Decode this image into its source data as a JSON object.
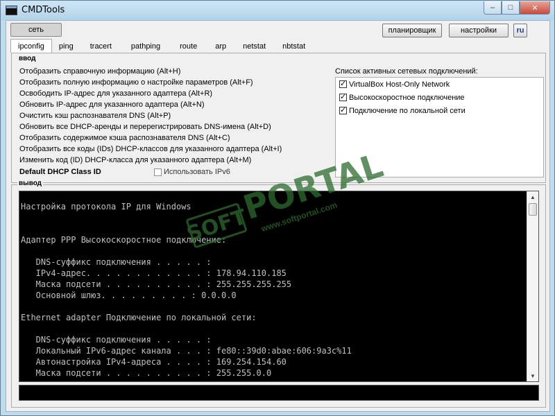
{
  "window": {
    "title": "CMDTools",
    "buttons": {
      "minimize": "–",
      "maximize": "□",
      "close": "✕"
    }
  },
  "toolbar": {
    "network_button": "сеть",
    "scheduler_button": "планировщик",
    "settings_button": "настройки",
    "language_button": "ru"
  },
  "tabs": [
    "ipconfig",
    "ping",
    "tracert",
    "pathping",
    "route",
    "arp",
    "netstat",
    "nbtstat"
  ],
  "active_tab": "ipconfig",
  "input_group": {
    "label": "ввод",
    "commands": [
      "Отобразить справочную информацию (Alt+H)",
      "Отобразить полную информацию о настройке параметров (Alt+F)",
      "Освободить IP-адрес для указанного адаптера (Alt+R)",
      "Обновить IP-адрес для указанного адаптера (Alt+N)",
      "Очистить кэш распознавателя DNS (Alt+P)",
      "Обновить все DHCP-аренды и перерегистрировать DNS-имена (Alt+D)",
      "Отобразить содержимое кэша распознавателя DNS (Alt+C)",
      "Отобразить все коды (IDs) DHCP-классов для указанного адаптера (Alt+I)",
      "Изменить код (ID) DHCP-класса для указанного адаптера (Alt+M)"
    ],
    "class_id_label": "Default DHCP Class ID",
    "ipv6_checkbox": {
      "label": "Использовать IPv6",
      "checked": false
    }
  },
  "connections": {
    "label": "Список активных сетевых подключений:",
    "items": [
      {
        "label": "VirtualBox Host-Only Network",
        "checked": true
      },
      {
        "label": "Высокоскоростное подключение",
        "checked": true
      },
      {
        "label": "Подключение по локальной сети",
        "checked": true
      }
    ]
  },
  "output_group": {
    "label": "вывод",
    "console_lines": [
      "Настройка протокола IP для Windows",
      "",
      "",
      "Адаптер PPP Высокоскоростное подключение:",
      "",
      "   DNS-суффикс подключения . . . . . :",
      "   IPv4-адрес. . . . . . . . . . . . : 178.94.110.185",
      "   Маска подсети . . . . . . . . . . : 255.255.255.255",
      "   Основной шлюз. . . . . . . . . : 0.0.0.0",
      "",
      "Ethernet adapter Подключение по локальной сети:",
      "",
      "   DNS-суффикс подключения . . . . . :",
      "   Локальный IPv6-адрес канала . . . : fe80::39d0:abae:606:9a3c%11",
      "   Автонастройка IPv4-адреса . . . . : 169.254.154.60",
      "   Маска подсети . . . . . . . . . . : 255.255.0.0"
    ]
  },
  "watermark": {
    "brand_left": "SOFT",
    "brand_right": "PORTAL",
    "url": "www.softportal.com"
  }
}
